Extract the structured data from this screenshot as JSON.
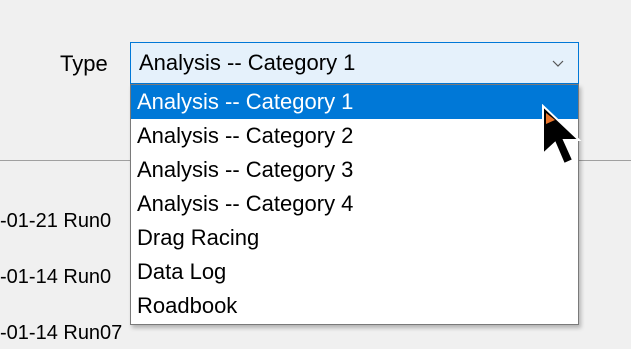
{
  "form": {
    "type_label": "Type",
    "selected_value": "Analysis -- Category 1",
    "dropdown_icon": "chevron-down-icon"
  },
  "dropdown": {
    "options": [
      "Analysis -- Category 1",
      "Analysis -- Category 2",
      "Analysis -- Category 3",
      "Analysis -- Category 4",
      "Drag Racing",
      "Data Log",
      "Roadbook"
    ],
    "highlighted_index": 0
  },
  "background_list": {
    "items": [
      "-01-21 Run0",
      "-01-14 Run0",
      "-01-14 Run07"
    ]
  },
  "colors": {
    "highlight": "#0078d7",
    "combo_background": "#e5f1fb",
    "window_background": "#f0f0f0",
    "cursor_accent": "#e8742a"
  },
  "cursor": {
    "icon": "mouse-pointer-icon"
  }
}
